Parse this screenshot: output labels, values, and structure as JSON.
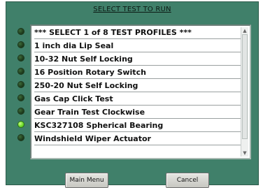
{
  "dialog": {
    "title": "SELECT TEST TO RUN"
  },
  "list": {
    "items": [
      {
        "label": "***  SELECT 1 of 8 TEST PROFILES  ***",
        "led_on": false
      },
      {
        "label": "1 inch dia Lip Seal",
        "led_on": false
      },
      {
        "label": "10-32 Nut Self Locking",
        "led_on": false
      },
      {
        "label": "16 Position Rotary Switch",
        "led_on": false
      },
      {
        "label": "250-20 Nut Self Locking",
        "led_on": false
      },
      {
        "label": "Gas Cap Click Test",
        "led_on": false
      },
      {
        "label": "Gear Train Test Clockwise",
        "led_on": false
      },
      {
        "label": "KSC327108 Spherical Bearing",
        "led_on": true
      },
      {
        "label": "Windshield Wiper Actuator",
        "led_on": false
      }
    ]
  },
  "buttons": {
    "main_menu": "Main Menu",
    "cancel": "Cancel"
  },
  "icons": {
    "led": "status-led-icon",
    "scroll_up": "chevron-up-icon",
    "scroll_down": "chevron-down-icon"
  },
  "colors": {
    "panel": "#40806a",
    "led_on": "#6fdc2c",
    "led_off": "#1e3b1c"
  }
}
